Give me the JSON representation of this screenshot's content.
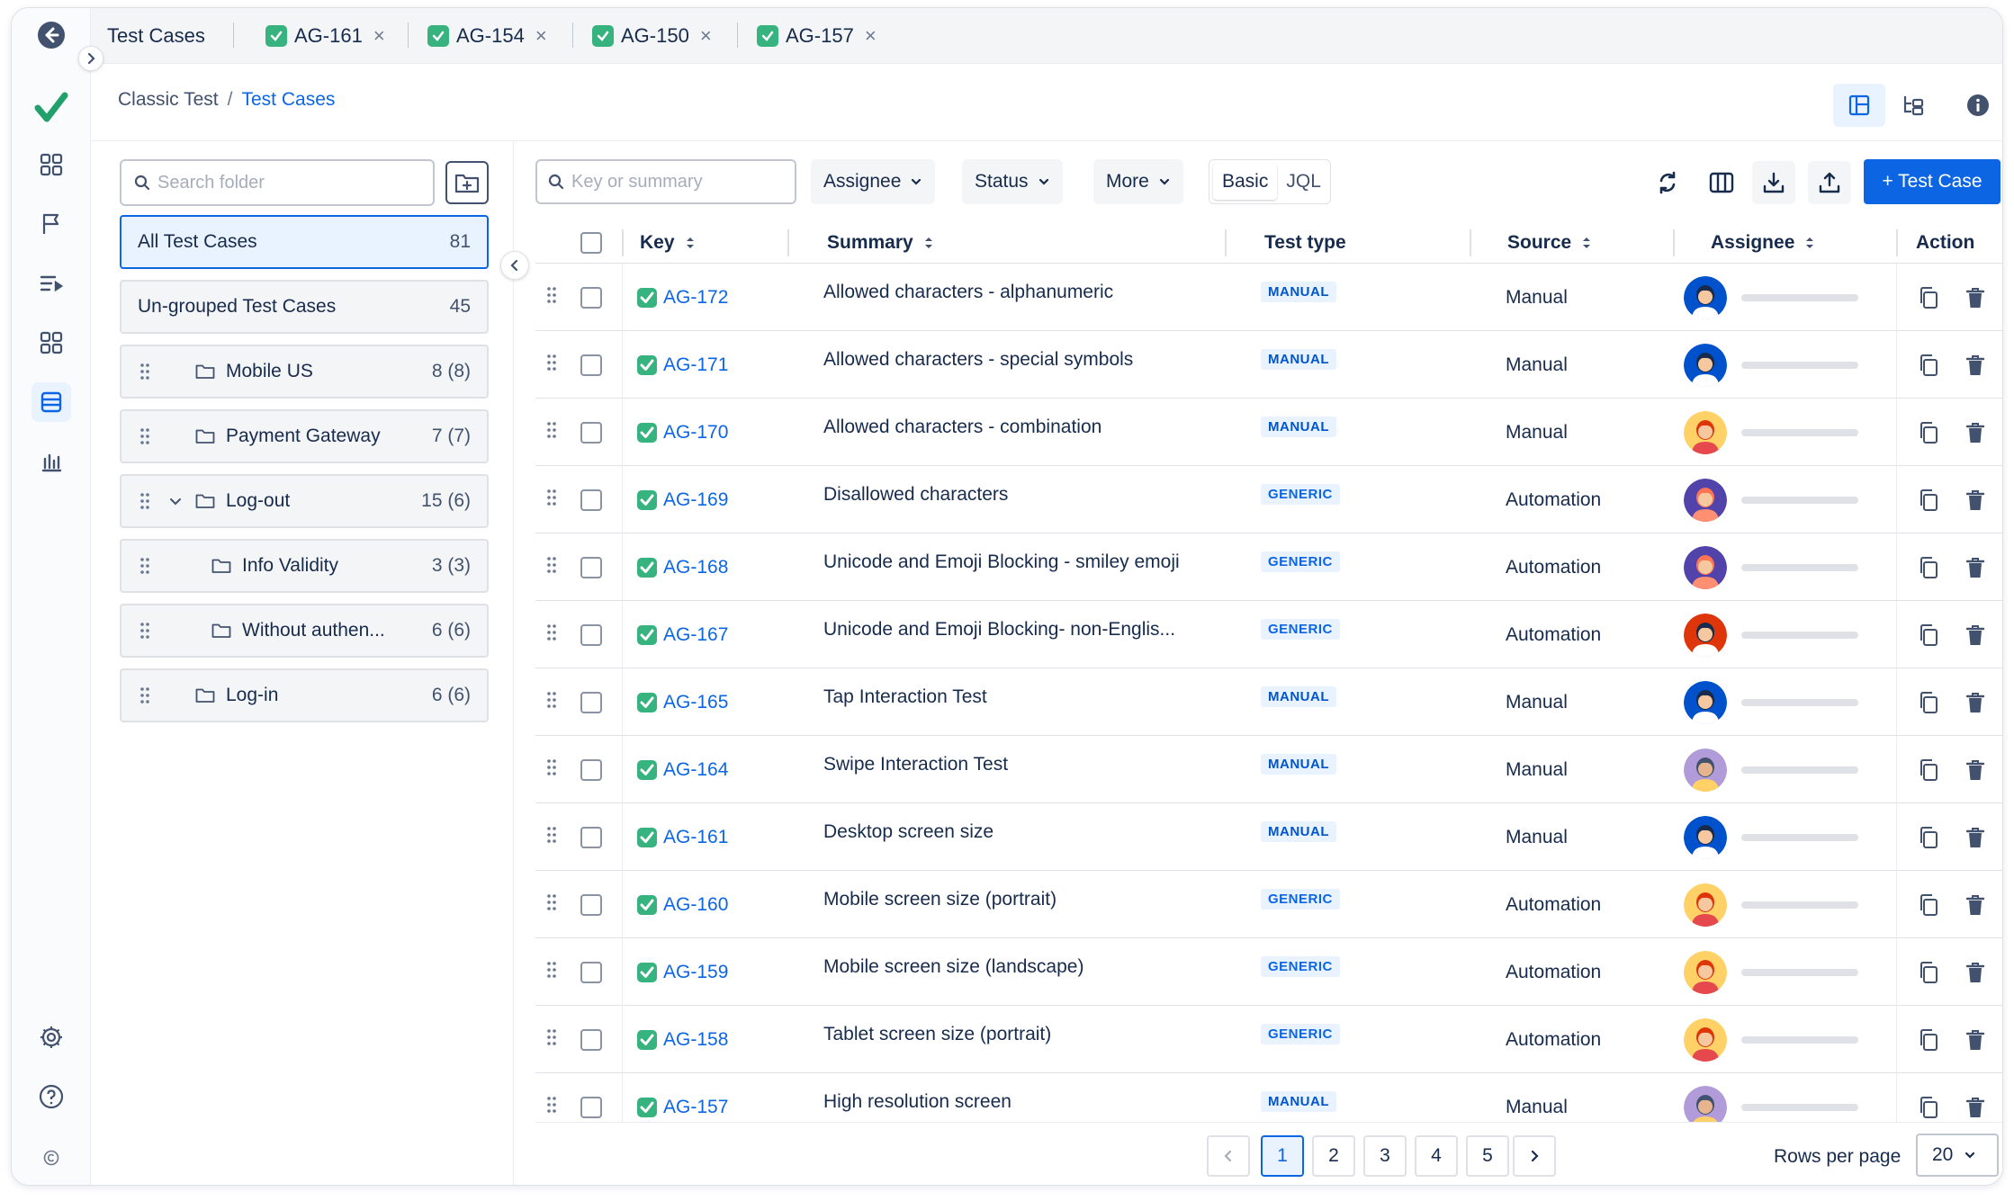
{
  "tabs": [
    {
      "label": "Test Cases",
      "icon": "",
      "closable": false
    },
    {
      "label": "AG-161",
      "icon": "test-tick-icon",
      "closable": true
    },
    {
      "label": "AG-154",
      "icon": "test-tick-icon",
      "closable": true
    },
    {
      "label": "AG-150",
      "icon": "test-tick-icon",
      "closable": true
    },
    {
      "label": "AG-157",
      "icon": "test-tick-icon",
      "closable": true
    }
  ],
  "tab_close_glyph": "×",
  "breadcrumb": {
    "parent": "Classic Test",
    "separator": "/",
    "current": "Test Cases"
  },
  "folders": {
    "search_placeholder": "Search folder",
    "all": {
      "label": "All Test Cases",
      "count": "81"
    },
    "ungrouped": {
      "label": "Un-grouped Test Cases",
      "count": "45"
    },
    "items": [
      {
        "label": "Mobile US",
        "count": "8 (8)",
        "indent": 0,
        "expanded": false
      },
      {
        "label": "Payment Gateway",
        "count": "7 (7)",
        "indent": 0,
        "expanded": false
      },
      {
        "label": "Log-out",
        "count": "15 (6)",
        "indent": 0,
        "expanded": true
      },
      {
        "label": "Info Validity",
        "count": "3 (3)",
        "indent": 1,
        "expanded": false
      },
      {
        "label": "Without authen...",
        "count": "6 (6)",
        "indent": 1,
        "expanded": false
      },
      {
        "label": "Log-in",
        "count": "6 (6)",
        "indent": 0,
        "expanded": false
      }
    ]
  },
  "toolbar": {
    "search_placeholder": "Key or summary",
    "assignee": "Assignee",
    "status": "Status",
    "more": "More",
    "mode_basic": "Basic",
    "mode_jql": "JQL",
    "new_button": "+ Test Case"
  },
  "columns": {
    "key": "Key",
    "summary": "Summary",
    "test_type": "Test type",
    "source": "Source",
    "assignee": "Assignee",
    "action": "Action"
  },
  "rows": [
    {
      "key": "AG-172",
      "summary": "Allowed characters - alphanumeric",
      "type": "MANUAL",
      "source": "Manual",
      "avatar": "blue"
    },
    {
      "key": "AG-171",
      "summary": "Allowed characters - special symbols",
      "type": "MANUAL",
      "source": "Manual",
      "avatar": "blue"
    },
    {
      "key": "AG-170",
      "summary": "Allowed characters - combination",
      "type": "MANUAL",
      "source": "Manual",
      "avatar": "yellow"
    },
    {
      "key": "AG-169",
      "summary": "Disallowed characters",
      "type": "GENERIC",
      "source": "Automation",
      "avatar": "purple"
    },
    {
      "key": "AG-168",
      "summary": "Unicode and Emoji Blocking - smiley emoji",
      "type": "GENERIC",
      "source": "Automation",
      "avatar": "purple"
    },
    {
      "key": "AG-167",
      "summary": "Unicode and Emoji Blocking- non-Englis...",
      "type": "GENERIC",
      "source": "Automation",
      "avatar": "red"
    },
    {
      "key": "AG-165",
      "summary": "Tap Interaction Test",
      "type": "MANUAL",
      "source": "Manual",
      "avatar": "blue"
    },
    {
      "key": "AG-164",
      "summary": "Swipe Interaction Test",
      "type": "MANUAL",
      "source": "Manual",
      "avatar": "mauve"
    },
    {
      "key": "AG-161",
      "summary": "Desktop screen size",
      "type": "MANUAL",
      "source": "Manual",
      "avatar": "blue"
    },
    {
      "key": "AG-160",
      "summary": "Mobile screen size (portrait)",
      "type": "GENERIC",
      "source": "Automation",
      "avatar": "yellow"
    },
    {
      "key": "AG-159",
      "summary": "Mobile screen size (landscape)",
      "type": "GENERIC",
      "source": "Automation",
      "avatar": "yellow"
    },
    {
      "key": "AG-158",
      "summary": "Tablet screen size (portrait)",
      "type": "GENERIC",
      "source": "Automation",
      "avatar": "yellow"
    },
    {
      "key": "AG-157",
      "summary": "High resolution screen",
      "type": "MANUAL",
      "source": "Manual",
      "avatar": "mauve"
    }
  ],
  "pagination": {
    "pages": [
      "1",
      "2",
      "3",
      "4",
      "5"
    ],
    "current": "1",
    "rows_per_page_label": "Rows per page",
    "rows_per_page": "20"
  },
  "colors": {
    "accent": "#0c66e4",
    "success": "#36b37e",
    "logo": "#22a06b"
  }
}
